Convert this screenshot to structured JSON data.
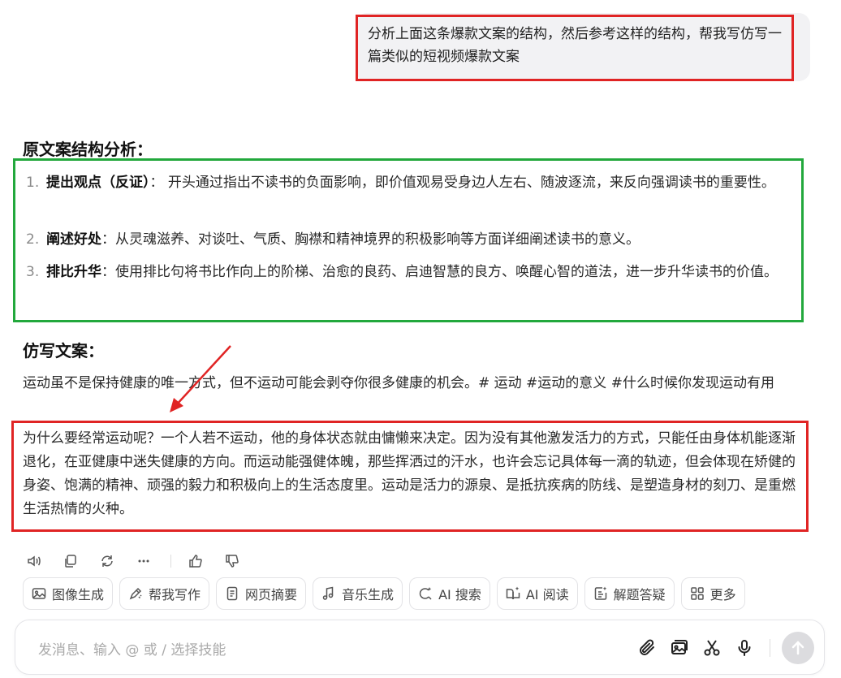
{
  "user_message": "分析上面这条爆款文案的结构，然后参考这样的结构，帮我写仿写一篇类似的短视频爆款文案",
  "analysis": {
    "heading": "原文案结构分析：",
    "items": [
      {
        "num": "1.",
        "title": "提出观点（反证）",
        "sep": "： ",
        "text": "开头通过指出不读书的负面影响，即价值观易受身边人左右、随波逐流，来反向强调读书的重要性。"
      },
      {
        "num": "2.",
        "title": "阐述好处",
        "sep": "：",
        "text": "从灵魂滋养、对谈吐、气质、胸襟和精神境界的积极影响等方面详细阐述读书的意义。"
      },
      {
        "num": "3.",
        "title": "排比升华",
        "sep": "：",
        "text": "使用排比句将书比作向上的阶梯、治愈的良药、启迪智慧的良方、唤醒心智的道法，进一步升华读书的价值。"
      }
    ]
  },
  "imitation": {
    "heading": "仿写文案：",
    "intro": "运动虽不是保持健康的唯一方式，但不运动可能会剥夺你很多健康的机会。# 运动 #运动的意义 #什么时候你发现运动有用",
    "body": "为什么要经常运动呢？一个人若不运动，他的身体状态就由慵懒来决定。因为没有其他激发活力的方式，只能任由身体机能逐渐退化，在亚健康中迷失健康的方向。而运动能强健体魄，那些挥洒过的汗水，也许会忘记具体每一滴的轨迹，但会体现在矫健的身姿、饱满的精神、顽强的毅力和积极向上的生活态度里。运动是活力的源泉、是抵抗疾病的防线、是塑造身材的刻刀、是重燃生活热情的火种。"
  },
  "actions": [
    "speaker-icon",
    "copy-icon",
    "regenerate-icon",
    "more-icon",
    "thumbs-up-icon",
    "thumbs-down-icon"
  ],
  "tools": [
    {
      "icon": "image-icon",
      "label": "图像生成"
    },
    {
      "icon": "pen-icon",
      "label": "帮我写作"
    },
    {
      "icon": "page-icon",
      "label": "网页摘要"
    },
    {
      "icon": "music-icon",
      "label": "音乐生成"
    },
    {
      "icon": "ai-search-icon",
      "label": "AI 搜索"
    },
    {
      "icon": "ai-read-icon",
      "label": "AI 阅读"
    },
    {
      "icon": "qa-icon",
      "label": "解题答疑"
    },
    {
      "icon": "grid-icon",
      "label": "更多"
    }
  ],
  "input": {
    "placeholder": "发消息、输入 @ 或 / 选择技能"
  },
  "colors": {
    "highlight_red": "#e02424",
    "highlight_green": "#22a83c"
  }
}
